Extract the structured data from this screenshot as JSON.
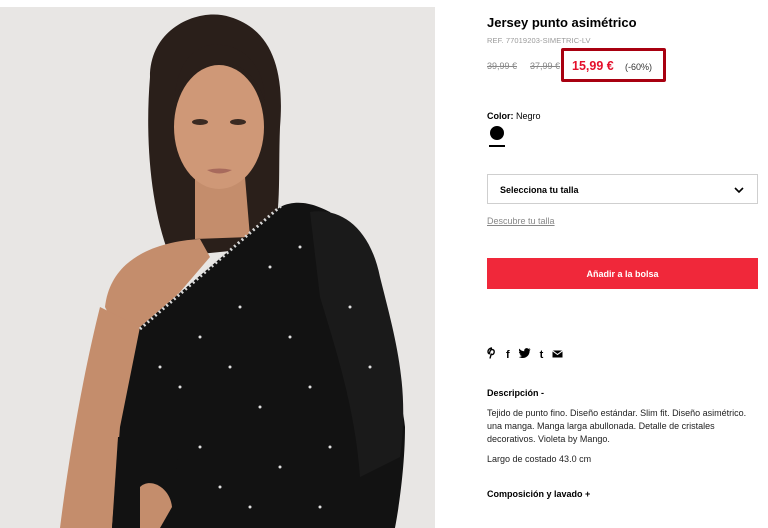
{
  "product": {
    "title": "Jersey punto asimétrico",
    "reference": "REF. 77019203-SIMETRIC-LV",
    "old_prices": [
      "39,99 €",
      "37,99 €"
    ],
    "price": "15,99 €",
    "discount": "(-60%)",
    "image_alt": "Modelo con jersey negro asimétrico de un hombro con cristales decorativos"
  },
  "color": {
    "label": "Color:",
    "value": "Negro",
    "swatch_color": "#000000"
  },
  "size": {
    "select_label": "Selecciona tu talla",
    "guide_link": "Descubre tu talla"
  },
  "actions": {
    "add_to_bag": "Añadir a la bolsa"
  },
  "share": {
    "icons": [
      "pinterest-icon",
      "facebook-icon",
      "twitter-icon",
      "tumblr-icon",
      "email-icon"
    ],
    "glyphs": [
      "℗",
      "f",
      "🐦",
      "t",
      "✉"
    ]
  },
  "description": {
    "heading": "Descripción  -",
    "text": "Tejido de punto fino. Diseño estándar. Slim fit. Diseño asimétrico. una manga. Manga larga abullonada. Detalle de cristales decorativos. Violeta by Mango.",
    "extra": "Largo de costado 43.0 cm"
  },
  "composition": {
    "heading": "Composición y lavado  +"
  },
  "colors": {
    "price_red": "#e40f2b",
    "highlight_box": "#a80010",
    "button_red": "#f0283a"
  }
}
